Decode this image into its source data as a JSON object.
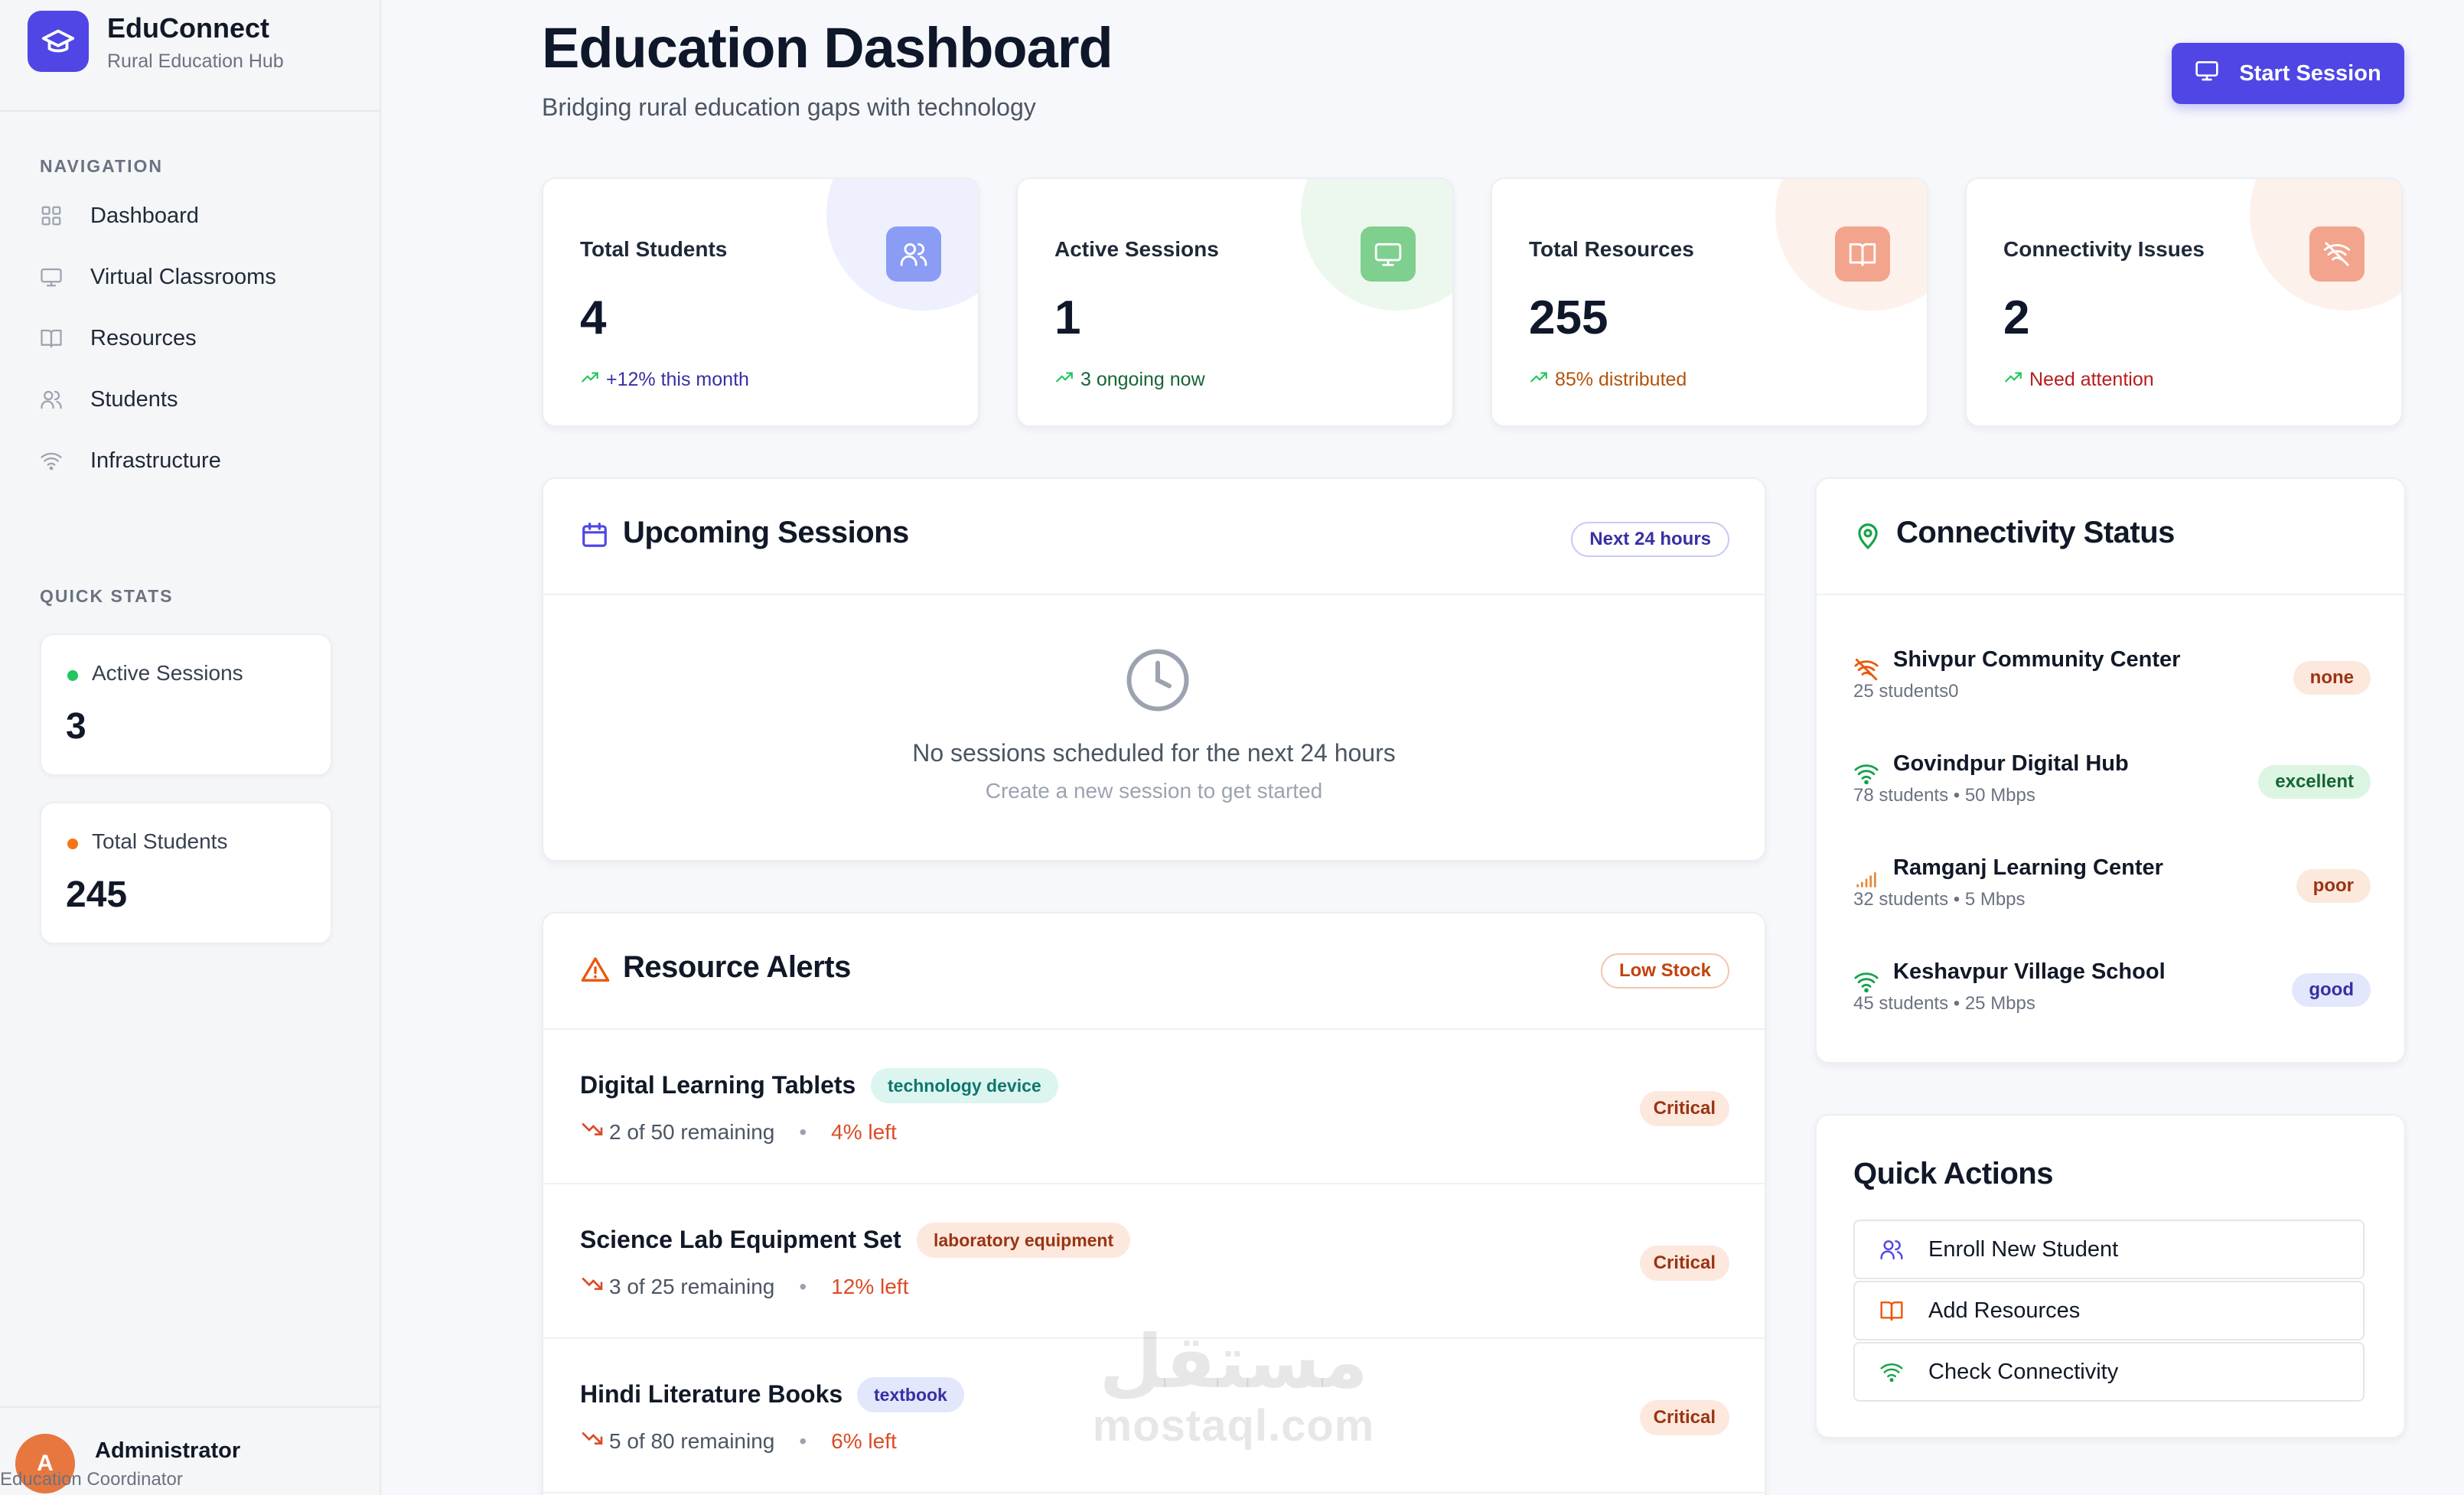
{
  "brand": {
    "title": "EduConnect",
    "subtitle": "Rural Education Hub"
  },
  "sidebar": {
    "nav_label": "NAVIGATION",
    "items": [
      {
        "label": "Dashboard",
        "icon": "grid-icon"
      },
      {
        "label": "Virtual Classrooms",
        "icon": "monitor-icon"
      },
      {
        "label": "Resources",
        "icon": "book-icon"
      },
      {
        "label": "Students",
        "icon": "users-icon"
      },
      {
        "label": "Infrastructure",
        "icon": "wifi-icon"
      }
    ],
    "quick_stats_label": "QUICK STATS",
    "quick_stats": [
      {
        "label": "Active Sessions",
        "value": "3",
        "dot_color": "#22c55e"
      },
      {
        "label": "Total Students",
        "value": "245",
        "dot_color": "#f97316"
      }
    ],
    "user": {
      "initial": "A",
      "name": "Administrator",
      "role": "Education Coordinator"
    }
  },
  "header": {
    "title": "Education Dashboard",
    "subtitle": "Bridging rural education gaps with technology",
    "start_button": "Start Session"
  },
  "stats": [
    {
      "label": "Total Students",
      "value": "4",
      "trend": "+12% this month",
      "trend_color": "#3730a3",
      "icon": "users-icon",
      "accent": "#6b7ef0"
    },
    {
      "label": "Active Sessions",
      "value": "1",
      "trend": "3 ongoing now",
      "trend_color": "#166534",
      "icon": "monitor-icon",
      "accent": "#4caf6d"
    },
    {
      "label": "Total Resources",
      "value": "255",
      "trend": "85% distributed",
      "trend_color": "#b45309",
      "icon": "book-icon",
      "accent": "#f0957a"
    },
    {
      "label": "Connectivity Issues",
      "value": "2",
      "trend": "Need attention",
      "trend_color": "#b91c1c",
      "icon": "wifi-off-icon",
      "accent": "#f0957a"
    }
  ],
  "upcoming": {
    "title": "Upcoming Sessions",
    "badge": "Next 24 hours",
    "empty_title": "No sessions scheduled for the next 24 hours",
    "empty_sub": "Create a new session to get started"
  },
  "alerts": {
    "title": "Resource Alerts",
    "badge": "Low Stock",
    "items": [
      {
        "name": "Digital Learning Tablets",
        "tag": "technology device",
        "remaining": "2 of 50 remaining",
        "pct": "4% left",
        "status": "Critical"
      },
      {
        "name": "Science Lab Equipment Set",
        "tag": "laboratory equipment",
        "remaining": "3 of 25 remaining",
        "pct": "12% left",
        "status": "Critical"
      },
      {
        "name": "Hindi Literature Books",
        "tag": "textbook",
        "remaining": "5 of 80 remaining",
        "pct": "6% left",
        "status": "Critical"
      }
    ]
  },
  "connectivity": {
    "title": "Connectivity Status",
    "items": [
      {
        "name": "Shivpur Community Center",
        "meta": "25 students0",
        "status": "none"
      },
      {
        "name": "Govindpur Digital Hub",
        "meta": "78 students • 50 Mbps",
        "status": "excellent"
      },
      {
        "name": "Ramganj Learning Center",
        "meta": "32 students • 5 Mbps",
        "status": "poor"
      },
      {
        "name": "Keshavpur Village School",
        "meta": "45 students • 25 Mbps",
        "status": "good"
      }
    ]
  },
  "quick_actions": {
    "title": "Quick Actions",
    "items": [
      {
        "label": "Enroll New Student",
        "icon": "users-icon"
      },
      {
        "label": "Add Resources",
        "icon": "book-icon"
      },
      {
        "label": "Check Connectivity",
        "icon": "wifi-icon"
      }
    ]
  },
  "watermark": {
    "arabic": "مستقل",
    "latin": "mostaql.com"
  }
}
